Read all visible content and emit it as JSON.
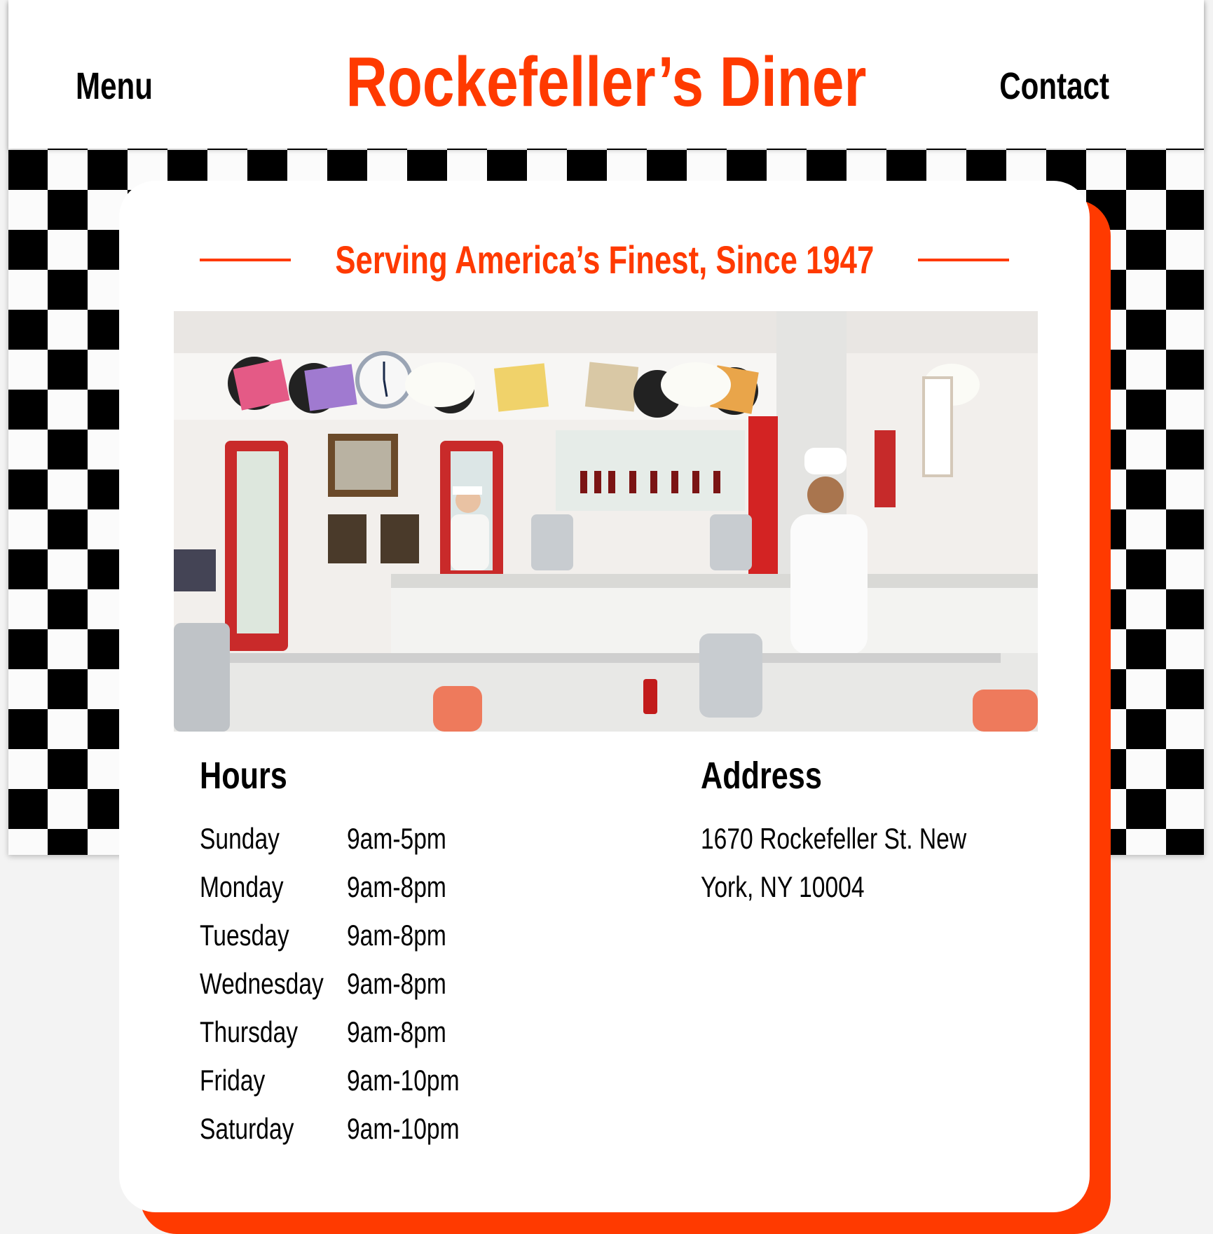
{
  "header": {
    "menu_label": "Menu",
    "title": "Rockefeller’s Diner",
    "contact_label": "Contact"
  },
  "card": {
    "tagline": "Serving America’s Finest, Since 1947",
    "photo_alt": "Interior of a retro diner with staff behind the counter",
    "hours": {
      "title": "Hours",
      "rows": [
        {
          "day": "Sunday",
          "time": "9am-5pm"
        },
        {
          "day": "Monday",
          "time": "9am-8pm"
        },
        {
          "day": "Tuesday",
          "time": "9am-8pm"
        },
        {
          "day": "Wednesday",
          "time": "9am-8pm"
        },
        {
          "day": "Thursday",
          "time": "9am-8pm"
        },
        {
          "day": "Friday",
          "time": "9am-10pm"
        },
        {
          "day": "Saturday",
          "time": "9am-10pm"
        }
      ]
    },
    "address": {
      "title": "Address",
      "line1": "1670 Rockefeller St. New",
      "line2": "York, NY 10004"
    }
  },
  "colors": {
    "accent": "#ff3a00",
    "text": "#000000",
    "checker_dark": "#000000",
    "checker_light": "#fbfbfb"
  }
}
